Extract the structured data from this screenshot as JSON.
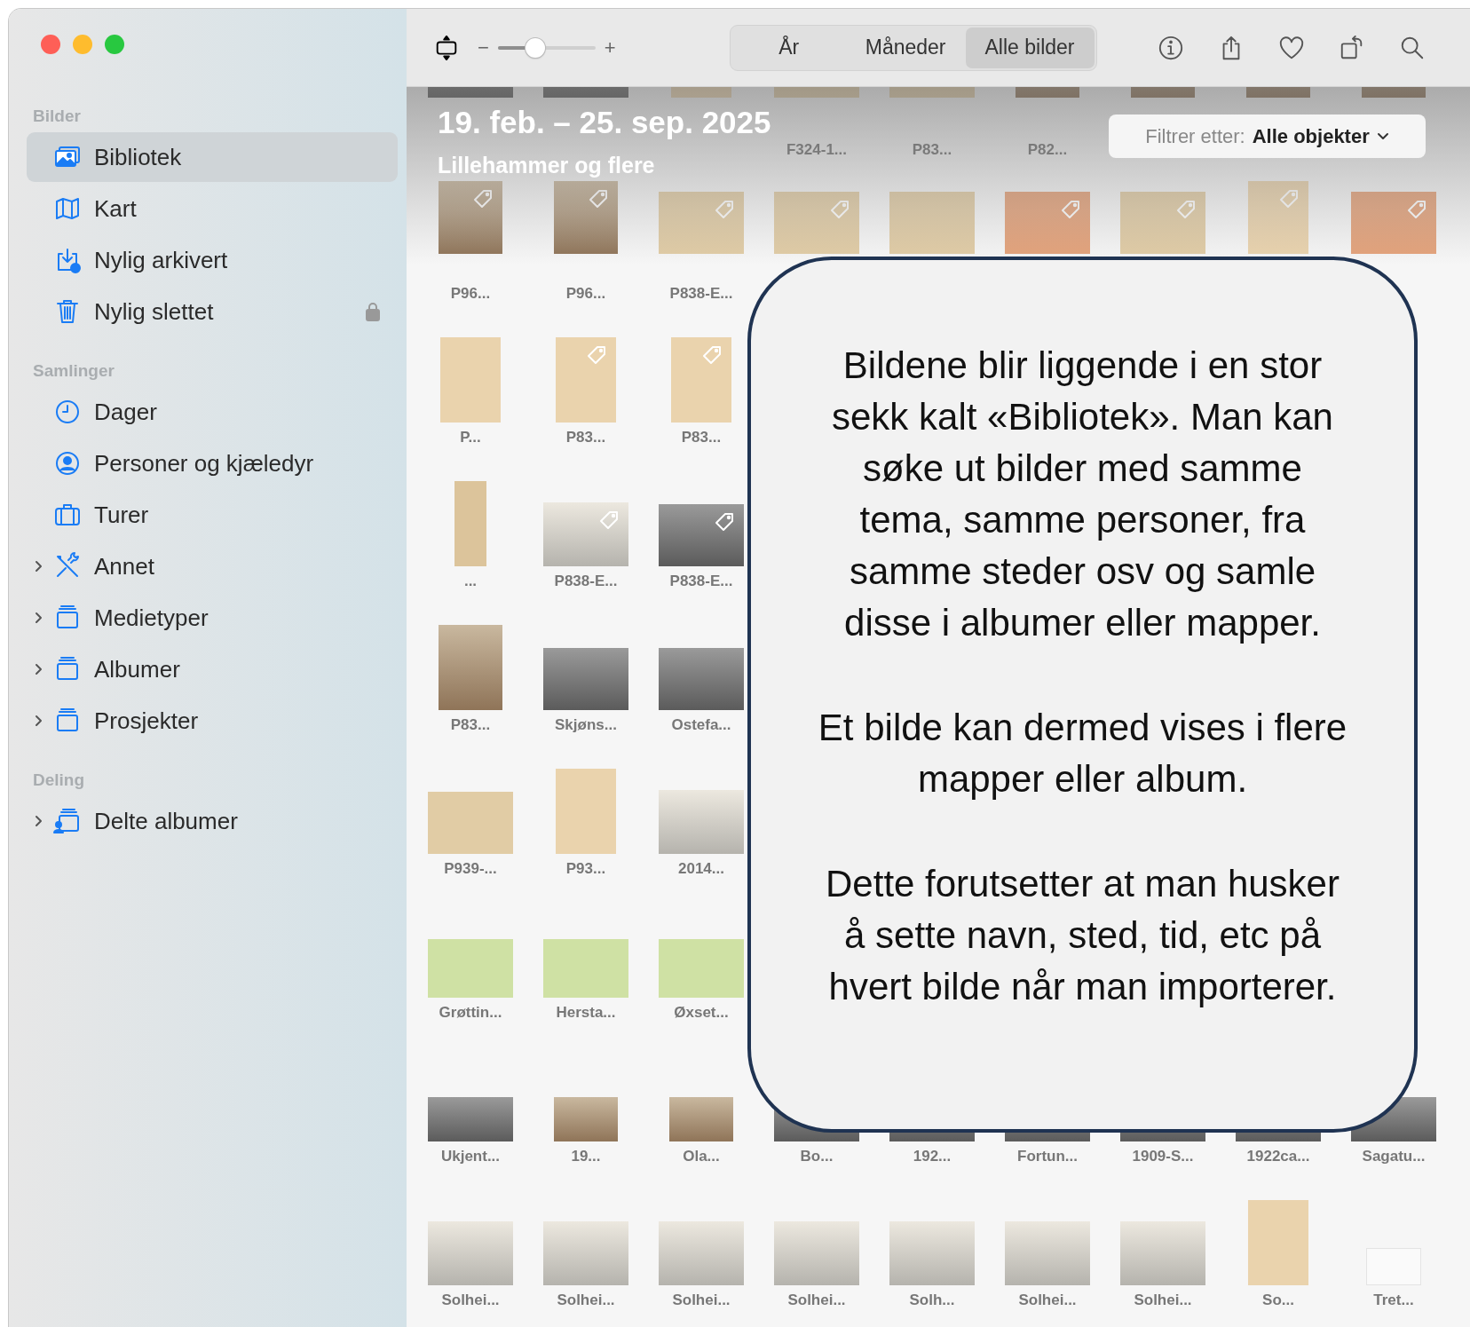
{
  "sidebar": {
    "sections": [
      {
        "title": "Bilder",
        "items": [
          {
            "label": "Bibliotek",
            "selected": true,
            "locked": false
          },
          {
            "label": "Kart",
            "selected": false,
            "locked": false
          },
          {
            "label": "Nylig arkivert",
            "selected": false,
            "locked": false
          },
          {
            "label": "Nylig slettet",
            "selected": false,
            "locked": true
          }
        ]
      },
      {
        "title": "Samlinger",
        "items": [
          {
            "label": "Dager",
            "selected": false,
            "locked": false
          },
          {
            "label": "Personer og kjæledyr",
            "selected": false,
            "locked": false
          },
          {
            "label": "Turer",
            "selected": false,
            "locked": false
          },
          {
            "label": "Annet",
            "selected": false,
            "expanded": false,
            "locked": false
          },
          {
            "label": "Medietyper",
            "selected": false,
            "expanded": false,
            "locked": false
          },
          {
            "label": "Albumer",
            "selected": false,
            "expanded": false,
            "locked": false
          },
          {
            "label": "Prosjekter",
            "selected": false,
            "expanded": false,
            "locked": false
          }
        ]
      },
      {
        "title": "Deling",
        "items": [
          {
            "label": "Delte albumer",
            "selected": false,
            "expanded": false,
            "locked": false
          }
        ]
      }
    ]
  },
  "toolbar": {
    "zoom": {
      "minus": "−",
      "plus": "+",
      "level": 0.38
    },
    "view_tabs": [
      {
        "label": "År",
        "selected": false
      },
      {
        "label": "Måneder",
        "selected": false
      },
      {
        "label": "Alle bilder",
        "selected": true
      }
    ]
  },
  "header": {
    "title": "19. feb. – 25. sep. 2025",
    "subtitle": "Lillehammer og flere",
    "filter": {
      "label": "Filtrer etter:",
      "value": "Alle objekter"
    }
  },
  "grid": {
    "rows": [
      [
        {
          "kind": "photo"
        },
        {
          "kind": "photo"
        },
        {
          "kind": "letter"
        },
        {
          "kind": "document",
          "label": "F324-1..."
        },
        {
          "kind": "document",
          "label": "P83..."
        },
        {
          "kind": "portrait",
          "label": "P82..."
        },
        {
          "kind": "portrait"
        },
        {
          "kind": "portrait"
        },
        {
          "kind": "portrait"
        }
      ],
      [
        {
          "kind": "portrait",
          "label": "P96...",
          "tagged": true
        },
        {
          "kind": "portrait",
          "label": "P96...",
          "tagged": true
        },
        {
          "kind": "document",
          "label": "P838-E...",
          "tagged": true
        },
        {
          "kind": "document",
          "tagged": true
        },
        {
          "kind": "document"
        },
        {
          "kind": "form",
          "tagged": true
        },
        {
          "kind": "document",
          "tagged": true
        },
        {
          "kind": "letter",
          "tagged": true
        },
        {
          "kind": "form",
          "tagged": true
        }
      ],
      [
        {
          "kind": "letter",
          "label": "P..."
        },
        {
          "kind": "letter",
          "label": "P83...",
          "tagged": true
        },
        {
          "kind": "letter",
          "label": "P83...",
          "tagged": true
        },
        null,
        null,
        null,
        null,
        null,
        null
      ],
      [
        {
          "kind": "strip",
          "label": "..."
        },
        {
          "kind": "clipping",
          "label": "P838-E...",
          "tagged": true
        },
        {
          "kind": "photo",
          "label": "P838-E...",
          "tagged": true
        },
        null,
        null,
        null,
        null,
        null,
        null
      ],
      [
        {
          "kind": "portrait",
          "label": "P83..."
        },
        {
          "kind": "photo",
          "label": "Skjøns..."
        },
        {
          "kind": "photo",
          "label": "Ostefa..."
        },
        null,
        null,
        null,
        null,
        null,
        null
      ],
      [
        {
          "kind": "document",
          "label": "P939-..."
        },
        {
          "kind": "letter",
          "label": "P93..."
        },
        {
          "kind": "clipping",
          "label": "2014..."
        },
        null,
        null,
        null,
        null,
        null,
        null
      ],
      [
        {
          "kind": "map",
          "label": "Grøttin..."
        },
        {
          "kind": "map",
          "label": "Hersta..."
        },
        {
          "kind": "map",
          "label": "Øxset..."
        },
        null,
        null,
        null,
        null,
        null,
        null
      ],
      [
        {
          "kind": "photo",
          "label": "Ukjent..."
        },
        {
          "kind": "portrait",
          "label": "19..."
        },
        {
          "kind": "portrait",
          "label": "Ola..."
        },
        {
          "kind": "photo",
          "label": "Bo..."
        },
        {
          "kind": "photo",
          "label": "192..."
        },
        {
          "kind": "photo",
          "label": "Fortun..."
        },
        {
          "kind": "photo",
          "label": "1909-S..."
        },
        {
          "kind": "photo",
          "label": "1922ca..."
        },
        {
          "kind": "photo",
          "label": "Sagatu..."
        }
      ],
      [
        {
          "kind": "clipping",
          "label": "Solhei..."
        },
        {
          "kind": "clipping",
          "label": "Solhei..."
        },
        {
          "kind": "clipping",
          "label": "Solhei..."
        },
        {
          "kind": "clipping",
          "label": "Solhei..."
        },
        {
          "kind": "clipping",
          "label": "Solh..."
        },
        {
          "kind": "clipping",
          "label": "Solhei..."
        },
        {
          "kind": "clipping",
          "label": "Solhei..."
        },
        {
          "kind": "letter",
          "label": "So..."
        },
        {
          "kind": "blank",
          "label": "Tret..."
        }
      ]
    ]
  },
  "callout": {
    "paragraphs": [
      "Bildene blir liggende i en stor sekk kalt «Bibliotek». Man kan søke ut bilder med samme tema, samme personer, fra samme steder osv og samle disse i albumer eller mapper.",
      "Et bilde kan dermed vises i flere mapper eller album.",
      "Dette forutsetter at man husker å sette navn, sted, tid, etc på hvert bilde når man importerer."
    ]
  }
}
